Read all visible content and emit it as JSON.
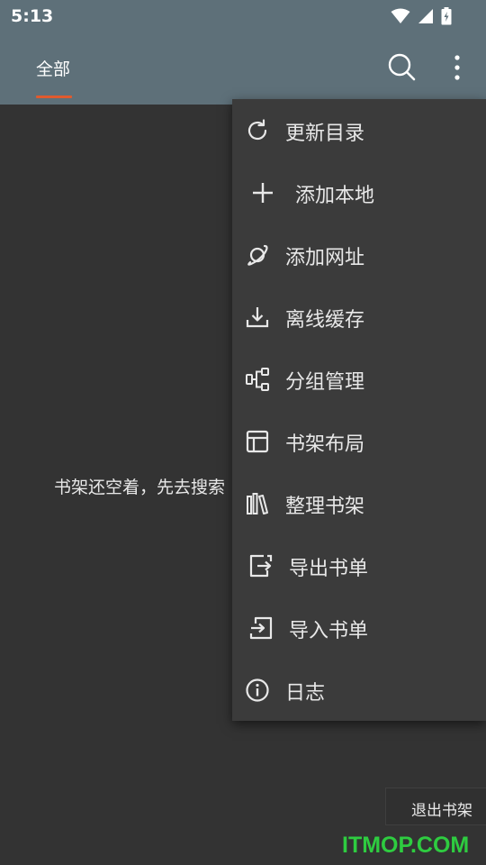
{
  "status_bar": {
    "time": "5:13"
  },
  "app_bar": {
    "tab_all": "全部",
    "search_icon": "search-icon",
    "more_icon": "more-vert-icon"
  },
  "empty_state": {
    "message": "书架还空着，先去搜索"
  },
  "exit_button": {
    "label": "退出书架"
  },
  "watermark": {
    "text": "ITMOP.COM"
  },
  "menu": {
    "items": [
      {
        "label": "更新目录",
        "icon": "refresh-icon"
      },
      {
        "label": "添加本地",
        "icon": "plus-icon"
      },
      {
        "label": "添加网址",
        "icon": "planet-icon"
      },
      {
        "label": "离线缓存",
        "icon": "download-icon"
      },
      {
        "label": "分组管理",
        "icon": "group-icon"
      },
      {
        "label": "书架布局",
        "icon": "layout-icon"
      },
      {
        "label": "整理书架",
        "icon": "books-icon"
      },
      {
        "label": "导出书单",
        "icon": "export-icon"
      },
      {
        "label": "导入书单",
        "icon": "import-icon"
      },
      {
        "label": "日志",
        "icon": "info-icon"
      }
    ]
  },
  "colors": {
    "app_bar": "#5e7079",
    "background": "#333333",
    "menu": "#3b3b3b",
    "tab_indicator": "#e05a2e",
    "watermark": "#2ecc40"
  }
}
